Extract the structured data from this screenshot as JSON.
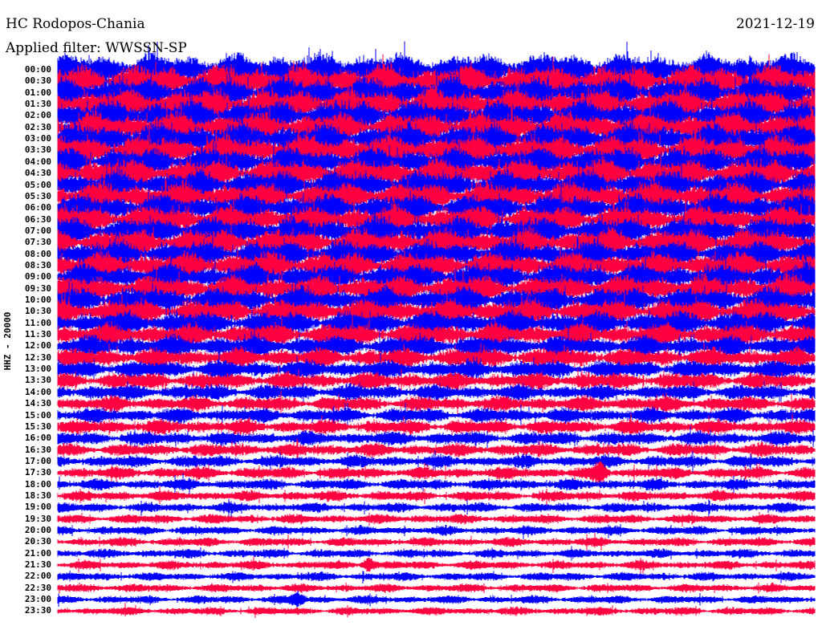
{
  "header": {
    "station": "HC Rodopos-Chania",
    "date": "2021-12-19",
    "filter": "Applied filter: WWSSN-SP"
  },
  "chart_data": {
    "type": "line",
    "title": "HC Rodopos-Chania",
    "ylabel": "HHZ - 20000",
    "xlabel": "",
    "minutes_per_line": 30,
    "colors": [
      "#0000ff",
      "#ff0040"
    ],
    "row_labels": [
      "00:00",
      "00:30",
      "01:00",
      "01:30",
      "02:00",
      "02:30",
      "03:00",
      "03:30",
      "04:00",
      "04:30",
      "05:00",
      "05:30",
      "06:00",
      "06:30",
      "07:00",
      "07:30",
      "08:00",
      "08:30",
      "09:00",
      "09:30",
      "10:00",
      "10:30",
      "11:00",
      "11:30",
      "12:00",
      "12:30",
      "13:00",
      "13:30",
      "14:00",
      "14:30",
      "15:00",
      "15:30",
      "16:00",
      "16:30",
      "17:00",
      "17:30",
      "18:00",
      "18:30",
      "19:00",
      "19:30",
      "20:00",
      "20:30",
      "21:00",
      "21:30",
      "22:00",
      "22:30",
      "23:00",
      "23:30"
    ],
    "relative_amplitude": [
      1.0,
      1.0,
      0.98,
      0.97,
      0.97,
      0.96,
      0.95,
      0.95,
      0.9,
      0.9,
      0.88,
      0.88,
      0.86,
      0.86,
      0.85,
      0.85,
      0.84,
      0.84,
      0.82,
      0.82,
      0.8,
      0.78,
      0.74,
      0.7,
      0.66,
      0.6,
      0.56,
      0.52,
      0.48,
      0.46,
      0.46,
      0.44,
      0.42,
      0.4,
      0.38,
      0.37,
      0.34,
      0.32,
      0.3,
      0.29,
      0.28,
      0.28,
      0.27,
      0.27,
      0.26,
      0.26,
      0.25,
      0.25
    ],
    "events": [
      {
        "row": "17:30",
        "minute": 21.5
      },
      {
        "row": "21:30",
        "minute": 12.3
      },
      {
        "row": "23:00",
        "minute": 9.5
      }
    ]
  }
}
